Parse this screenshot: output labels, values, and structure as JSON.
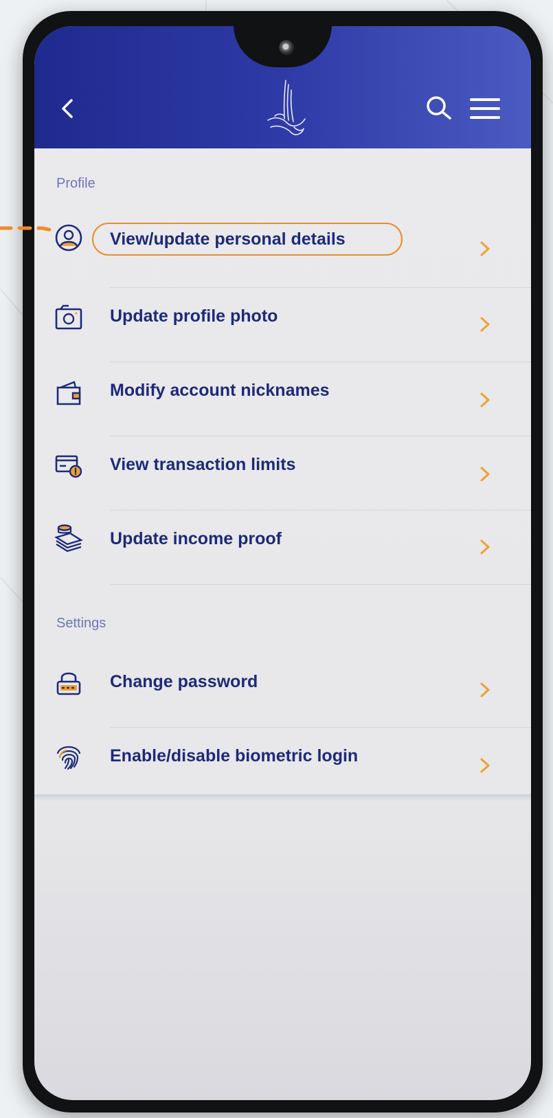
{
  "colors": {
    "header_start": "#1f2a8f",
    "header_end": "#4b5bc2",
    "item_text": "#1d2a7a",
    "section_text": "#6e76b8",
    "chevron": "#f0a030",
    "highlight": "#f08a24"
  },
  "header": {
    "back_icon": "chevron-left-icon",
    "logo_icon": "calligraphy-logo-icon",
    "search_icon": "search-icon",
    "menu_icon": "hamburger-menu-icon"
  },
  "profile": {
    "section_label": "Profile",
    "items": [
      {
        "label": "View/update personal details",
        "icon": "user-circle-icon",
        "highlighted": true
      },
      {
        "label": "Update profile photo",
        "icon": "camera-icon"
      },
      {
        "label": "Modify account nicknames",
        "icon": "wallet-icon"
      },
      {
        "label": "View transaction limits",
        "icon": "card-limit-icon"
      },
      {
        "label": "Update income proof",
        "icon": "money-stack-icon"
      }
    ]
  },
  "settings": {
    "section_label": "Settings",
    "items": [
      {
        "label": "Change password",
        "icon": "lock-password-icon"
      },
      {
        "label": "Enable/disable biometric login",
        "icon": "fingerprint-icon"
      }
    ]
  }
}
